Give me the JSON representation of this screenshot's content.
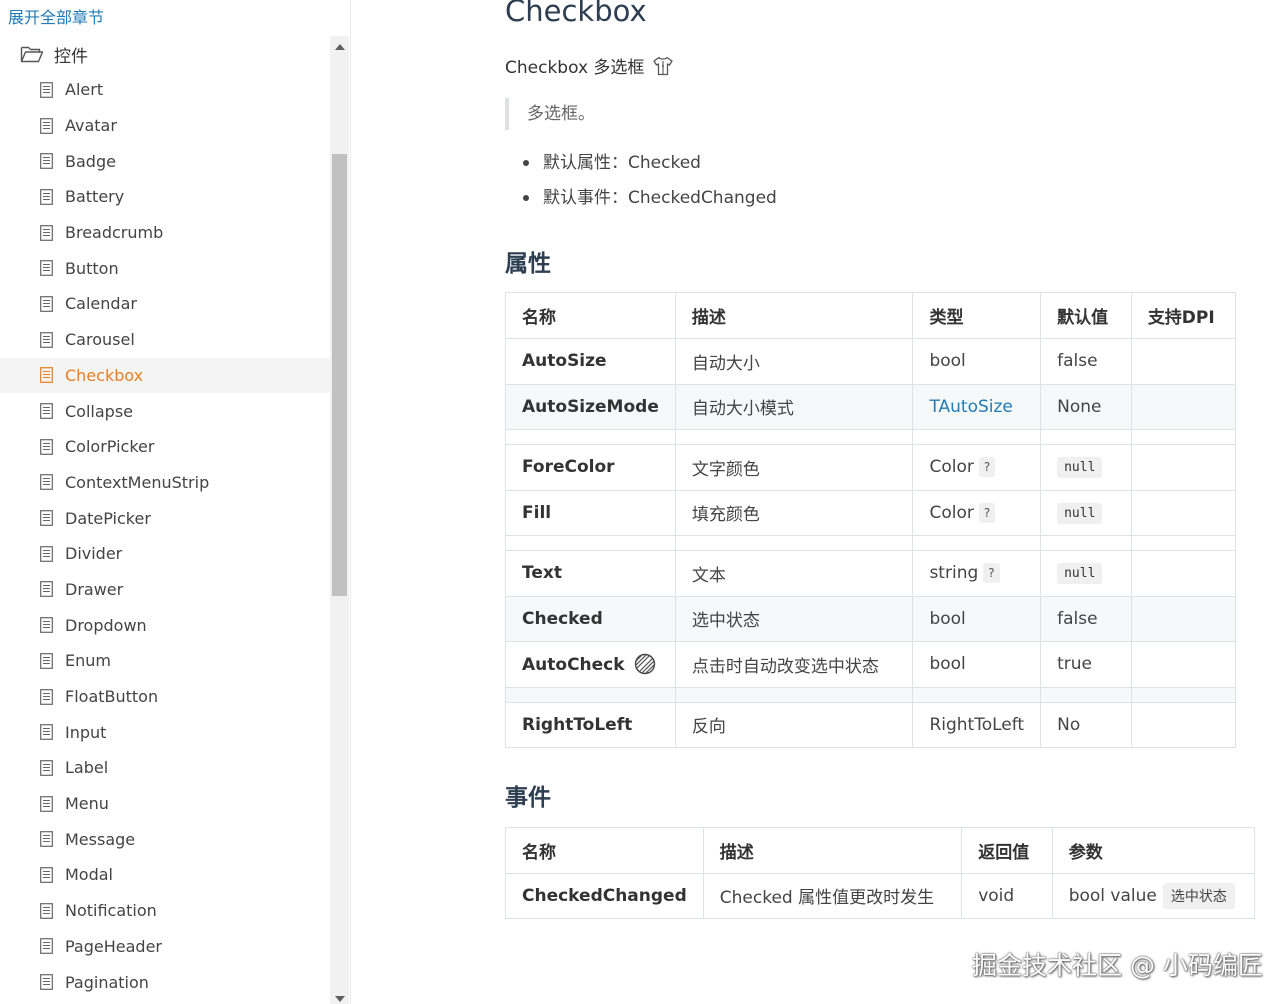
{
  "sidebar": {
    "expand_all": "展开全部章节",
    "folder_label": "控件",
    "items": [
      "Alert",
      "Avatar",
      "Badge",
      "Battery",
      "Breadcrumb",
      "Button",
      "Calendar",
      "Carousel",
      "Checkbox",
      "Collapse",
      "ColorPicker",
      "ContextMenuStrip",
      "DatePicker",
      "Divider",
      "Drawer",
      "Dropdown",
      "Enum",
      "FloatButton",
      "Input",
      "Label",
      "Menu",
      "Message",
      "Modal",
      "Notification",
      "PageHeader",
      "Pagination"
    ],
    "active_item": "Checkbox"
  },
  "main": {
    "title": "Checkbox",
    "subtitle": "Checkbox 多选框",
    "quote": "多选框。",
    "bullets": [
      "默认属性：Checked",
      "默认事件：CheckedChanged"
    ],
    "properties_heading": "属性",
    "events_heading": "事件"
  },
  "props_table": {
    "headers": [
      "名称",
      "描述",
      "类型",
      "默认值",
      "支持DPI"
    ],
    "rows": {
      "r0": {
        "name": "AutoSize",
        "desc": "自动大小",
        "type": "bool",
        "default": "false"
      },
      "r1": {
        "name": "AutoSizeMode",
        "desc": "自动大小模式",
        "type": "TAutoSize",
        "default": "None"
      },
      "r2": {
        "name": "ForeColor",
        "desc": "文字颜色",
        "type": "Color",
        "badge": "?",
        "default": "null"
      },
      "r3": {
        "name": "Fill",
        "desc": "填充颜色",
        "type": "Color",
        "badge": "?",
        "default": "null"
      },
      "r4": {
        "name": "Text",
        "desc": "文本",
        "type": "string",
        "badge": "?",
        "default": "null"
      },
      "r5": {
        "name": "Checked",
        "desc": "选中状态",
        "type": "bool",
        "default": "false"
      },
      "r6": {
        "name": "AutoCheck",
        "desc": "点击时自动改变选中状态",
        "type": "bool",
        "default": "true"
      },
      "r7": {
        "name": "RightToLeft",
        "desc": "反向",
        "type": "RightToLeft",
        "default": "No"
      }
    }
  },
  "events_table": {
    "headers": [
      "名称",
      "描述",
      "返回值",
      "参数"
    ],
    "row": {
      "name": "CheckedChanged",
      "desc": "Checked 属性值更改时发生",
      "returns": "void",
      "param": "bool value",
      "param_tag": "选中状态"
    }
  },
  "watermark": "掘金技术社区 @ 小码编匠",
  "colors": {
    "link": "#1f7bb6",
    "active": "#e67e22",
    "heading": "#2c3e50",
    "border": "#dfe2e5",
    "stripe": "#f6f8fa"
  }
}
